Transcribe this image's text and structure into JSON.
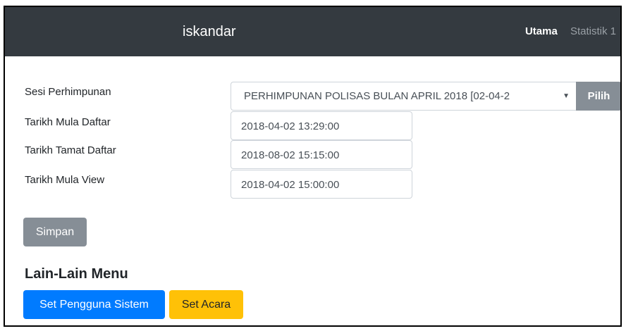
{
  "navbar": {
    "brand": "iskandar",
    "links": [
      {
        "label": "Utama",
        "active": true
      },
      {
        "label": "Statistik 1",
        "active": false
      }
    ]
  },
  "form": {
    "session": {
      "label": "Sesi Perhimpunan",
      "selected": "PERHIMPUNAN POLISAS BULAN APRIL 2018 [02-04-2",
      "button": "Pilih"
    },
    "fields": [
      {
        "label": "Tarikh Mula Daftar",
        "value": "2018-04-02 13:29:00"
      },
      {
        "label": "Tarikh Tamat Daftar",
        "value": "2018-08-02 15:15:00"
      },
      {
        "label": "Tarikh Mula View",
        "value": "2018-04-02 15:00:00"
      }
    ],
    "save_label": "Simpan"
  },
  "other_menu": {
    "title": "Lain-Lain Menu",
    "buttons": [
      {
        "label": "Set Pengguna Sistem",
        "color": "#007bff"
      },
      {
        "label": "Set Acara",
        "color": "#ffc107"
      }
    ]
  },
  "colors": {
    "navbar_bg": "#343a40",
    "secondary": "#868e96",
    "primary": "#007bff",
    "warning": "#ffc107"
  }
}
